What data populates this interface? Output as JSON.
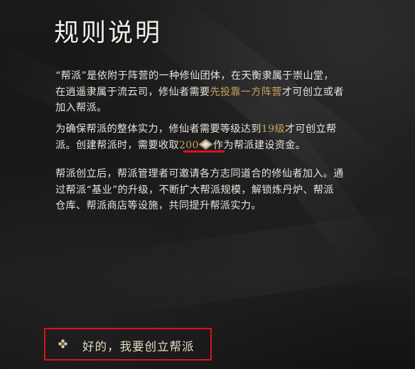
{
  "dialog": {
    "title": "规则说明",
    "paragraphs": {
      "p1": {
        "line1": "“帮派”是依附于阵营的一种修仙团体，在天衡隶属于崇山堂，",
        "line2_before": "在逍遥隶属于流云司，修仙者需要",
        "line2_highlight": "先投靠一方阵营",
        "line2_after": "才可创立或者",
        "line3": "加入帮派。"
      },
      "p2": {
        "line1_before": "为确保帮派的整体实力，修仙者需要等级达到",
        "level_requirement": "19级",
        "line1_after": "才可创立帮",
        "line2_before": "派。创建帮派时，需要收取",
        "cost_amount": "200",
        "currency_icon": "coin-icon",
        "line2_after": "作为帮派建设资金。"
      },
      "p3": {
        "line1": "帮派创立后，帮派管理者可邀请各方志同道合的修仙者加入。通",
        "line2": "过帮派“基业”的升级，不断扩大帮派规模，解锁炼丹炉、帮派",
        "line3": "仓库、帮派商店等设施，共同提升帮派实力。"
      }
    },
    "option": {
      "icon": "flower-bullet-icon",
      "label": "好的，我要创立帮派"
    }
  },
  "colors": {
    "highlight": "#c7a25c",
    "text": "#e7e3da",
    "annotation_red": "#d8141a"
  }
}
